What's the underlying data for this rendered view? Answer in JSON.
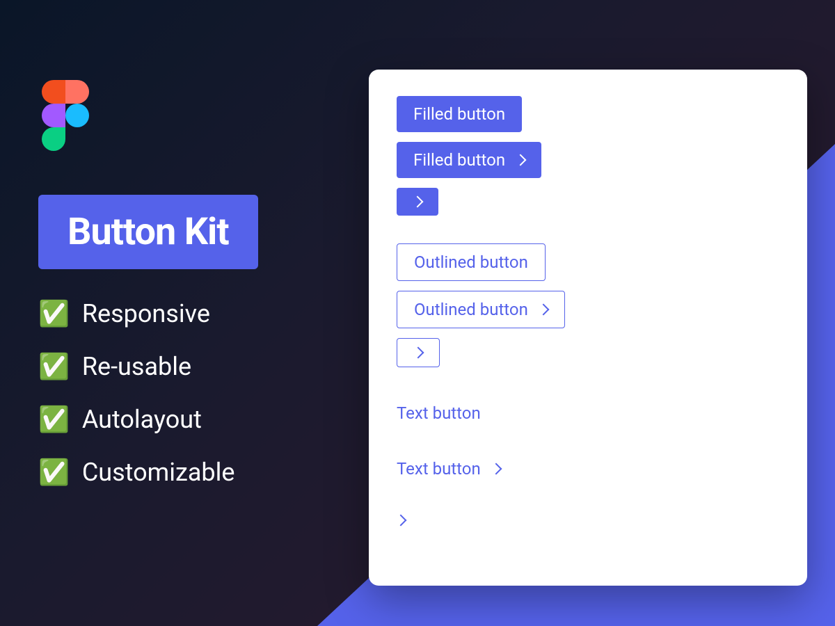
{
  "title": "Button Kit",
  "features": [
    "Responsive",
    "Re-usable",
    "Autolayout",
    "Customizable"
  ],
  "buttons": {
    "filled": {
      "label": "Filled button",
      "label_icon": "Filled button"
    },
    "outlined": {
      "label": "Outlined button",
      "label_icon": "Outlined button"
    },
    "text": {
      "label": "Text button",
      "label_icon": "Text button"
    }
  },
  "colors": {
    "accent": "#5562ea"
  }
}
